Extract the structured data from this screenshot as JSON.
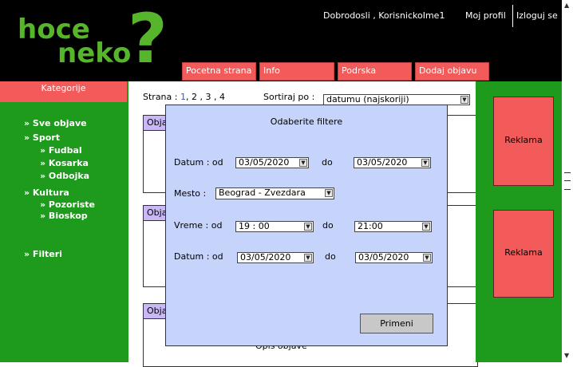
{
  "header": {
    "logo_line1": "hoce",
    "logo_line2": "neko",
    "logo_mark": "?",
    "greeting": "Dobrodosli , KorisnickoIme1",
    "profile": "Moj profil",
    "logout": "Izloguj se"
  },
  "nav": {
    "items": [
      "Pocetna strana",
      "Info",
      "Podrska",
      "Dodaj objavu"
    ]
  },
  "sidebar": {
    "heading": "Kategorije",
    "items": [
      "» Sve objave",
      "» Sport",
      "» Fudbal",
      "» Kosarka",
      "» Odbojka",
      "» Kultura",
      "» Pozoriste",
      "» Bioskop",
      "» Filteri"
    ]
  },
  "main": {
    "pager_label": "Strana :",
    "pages": [
      "1",
      "2",
      "3",
      "4"
    ],
    "sort_label": "Sortiraj po :",
    "sort_value": "datumu (najskoriji)",
    "card_tab": "Objava",
    "card_desc": "Opis objave"
  },
  "ads": {
    "label": "Reklama"
  },
  "modal": {
    "title": "Odaberite filtere",
    "date_label": "Datum : od",
    "to_label": "do",
    "place_label": "Mesto :",
    "time_label": "Vreme : od",
    "date_from": "03/05/2020",
    "date_to": "03/05/2020",
    "place_value": "Beograd - Zvezdara",
    "time_from": "19 : 00",
    "time_to": "21:00",
    "date2_from": "03/05/2020",
    "date2_to": "03/05/2020",
    "apply": "Primeni"
  },
  "icons": {
    "dropdown": "chevron-down-icon",
    "scroll_up": "arrow-up-icon",
    "scroll_down": "arrow-down-icon"
  },
  "colors": {
    "header_bg": "#000000",
    "green": "#1e9a1c",
    "red": "#f25b59",
    "modal_bg": "#c6d3fb",
    "tab_bg": "#c9b8f5",
    "logo": "#57b52c"
  }
}
